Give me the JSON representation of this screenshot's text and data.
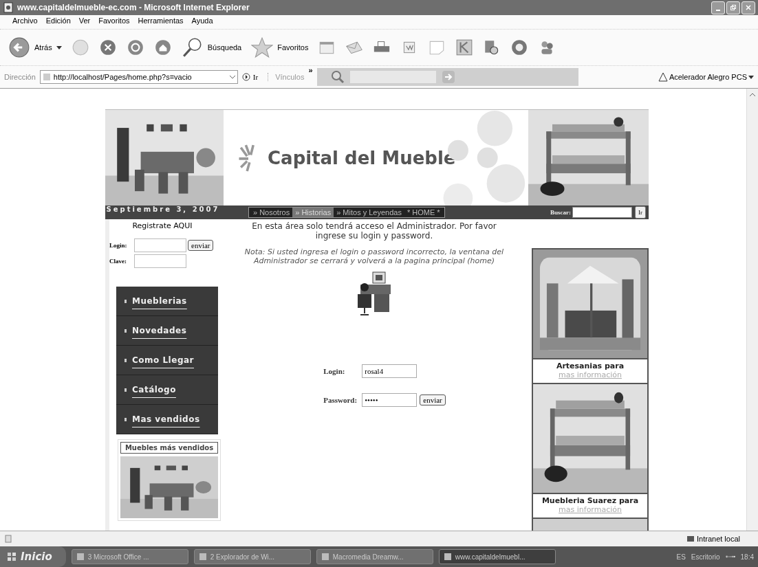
{
  "window": {
    "title": "www.capitaldelmueble-ec.com - Microsoft Internet Explorer"
  },
  "menu": [
    "Archivo",
    "Edición",
    "Ver",
    "Favoritos",
    "Herramientas",
    "Ayuda"
  ],
  "toolbar": {
    "back": "Atrás",
    "search": "Búsqueda",
    "favorites": "Favoritos"
  },
  "address_bar": {
    "label": "Dirección",
    "url": "http://localhost/Pages/home.php?s=vacio",
    "go": "Ir",
    "links": "Vínculos",
    "links_more": "»",
    "addon": "Acelerador Alegro PCS"
  },
  "page": {
    "banner": {
      "title": "Capital del Mueble"
    },
    "date": "Septiembre 3, 2007",
    "nav_links": [
      {
        "label": "» Nosotros",
        "selected": false
      },
      {
        "label": "» Historias",
        "selected": true
      },
      {
        "label": "» Mitos y Leyendas",
        "selected": false
      },
      {
        "label": "* HOME *",
        "selected": false
      }
    ],
    "search_label": "Buscar:",
    "search_button": "Ir",
    "register": "Registrate AQUI",
    "side_login": {
      "login_label": "Login:",
      "password_label": "Clave:",
      "button": "enviar"
    },
    "side_menu": [
      "Mueblerias",
      "Novedades",
      "Como Llegar",
      "Catálogo",
      "Mas vendidos"
    ],
    "bestsellers": "Muebles más vendidos",
    "intro": "En esta área solo tendrá acceso el Administrador. Por favor ingrese su login y password.",
    "note": "Nota: Si usted ingresa el login o password incorrecto, la ventana del Administrador se cerrará y volverá a la pagina principal (home)",
    "admin_form": {
      "login_label": "Login:",
      "login_value": "rosal4",
      "password_label": "Password:",
      "password_value": "•••••",
      "button": "enviar"
    },
    "ads": [
      {
        "title": "Artesanias para",
        "link": "mas información"
      },
      {
        "title": "Muebleria Suarez para",
        "link": "mas información"
      }
    ]
  },
  "status_bar": {
    "zone": "Intranet local"
  },
  "taskbar": {
    "start": "Inicio",
    "tasks": [
      {
        "label": "3 Microsoft Office ...",
        "selected": false
      },
      {
        "label": "2 Explorador de Wi...",
        "selected": false
      },
      {
        "label": "Macromedia Dreamw...",
        "selected": false
      },
      {
        "label": "www.capitaldelmuebl...",
        "selected": true
      }
    ],
    "language": "ES",
    "desktop": "Escritorio",
    "clock": "18:4"
  }
}
